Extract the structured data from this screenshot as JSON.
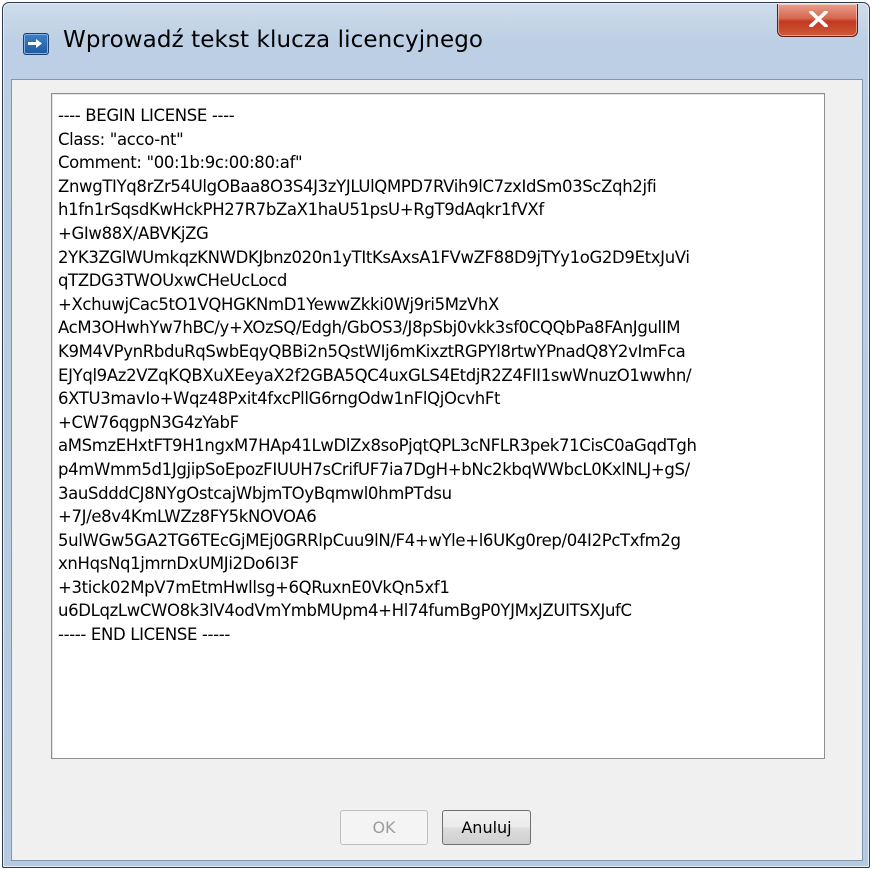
{
  "window": {
    "title": "Wprowadź tekst klucza licencyjnego",
    "icon": "dialog-app-icon",
    "close_icon": "close-x-icon"
  },
  "license": {
    "lines": [
      "---- BEGIN LICENSE ----",
      "Class: \"acco-nt\"",
      "Comment: \"00:1b:9c:00:80:af\"",
      "ZnwgTIYq8rZr54UlgOBaa8O3S4J3zYJLUlQMPD7RVih9lC7zxIdSm03ScZqh2jfi",
      "h1fn1rSqsdKwHckPH27R7bZaX1haU51psU+RgT9dAqkr1fVXf",
      "+GIw88X/ABVKjZG",
      "2YK3ZGlWUmkqzKNWDKJbnz020n1yTItKsAxsA1FVwZF88D9jTYy1oG2D9EtxJuVi",
      "qTZDG3TWOUxwCHeUcLocd",
      "+XchuwjCac5tO1VQHGKNmD1YewwZkki0Wj9ri5MzVhX",
      "AcM3OHwhYw7hBC/y+XOzSQ/Edgh/GbOS3/J8pSbj0vkk3sf0CQQbPa8FAnJgulIM",
      "K9M4VPynRbduRqSwbEqyQBBi2n5QstWIj6mKixztRGPYl8rtwYPnadQ8Y2vImFca",
      "EJYql9Az2VZqKQBXuXEeyaX2f2GBA5QC4uxGLS4EtdjR2Z4FII1swWnuzO1wwhn/",
      "6XTU3mavIo+Wqz48Pxit4fxcPllG6rngOdw1nFlQjOcvhFt",
      "+CW76qgpN3G4zYabF",
      "aMSmzEHxtFT9H1ngxM7HAp41LwDlZx8soPjqtQPL3cNFLR3pek71CisC0aGqdTgh",
      "p4mWmm5d1JgjipSoEpozFIUUH7sCrifUF7ia7DgH+bNc2kbqWWbcL0KxlNLJ+gS/",
      "3auSdddCJ8NYgOstcajWbjmTOyBqmwl0hmPTdsu",
      "+7J/e8v4KmLWZz8FY5kNOVOA6",
      "5ulWGw5GA2TG6TEcGjMEj0GRRlpCuu9lN/F4+wYle+l6UKg0rep/04I2PcTxfm2g",
      "xnHqsNq1jmrnDxUMJi2Do6I3F",
      "+3tick02MpV7mEtmHwllsg+6QRuxnE0VkQn5xf1",
      "u6DLqzLwCWO8k3lV4odVmYmbMUpm4+Hl74fumBgP0YJMxJZUITSXJufC",
      "----- END LICENSE -----"
    ]
  },
  "buttons": {
    "ok_label": "OK",
    "ok_enabled": false,
    "cancel_label": "Anuluj"
  }
}
